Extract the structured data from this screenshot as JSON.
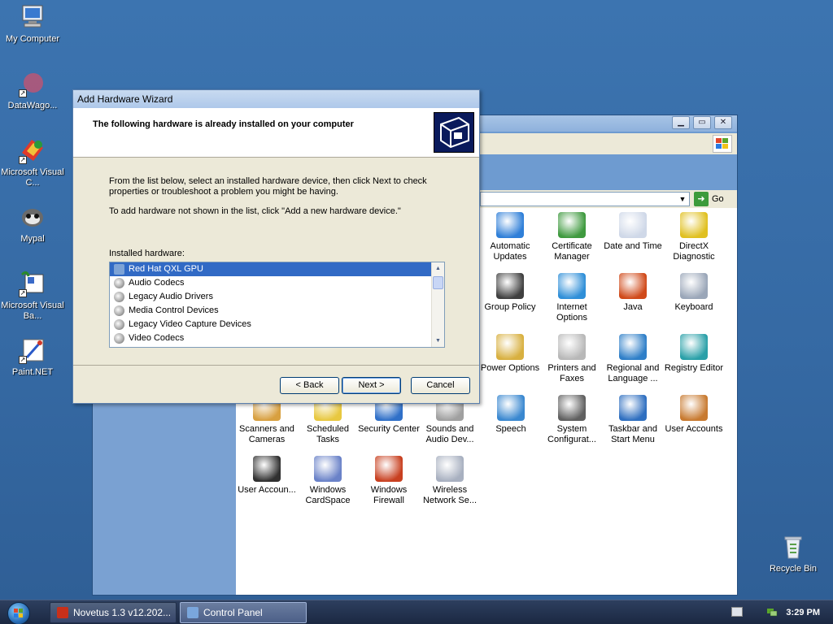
{
  "desktop": {
    "icons": [
      {
        "label": "My Computer",
        "icon": "my-computer-icon"
      },
      {
        "label": "DataWago...",
        "icon": "datawagon-icon"
      },
      {
        "label": "Microsoft Visual C...",
        "icon": "visual-c-icon"
      },
      {
        "label": "Mypal",
        "icon": "mypal-icon"
      },
      {
        "label": "Microsoft Visual Ba...",
        "icon": "visual-basic-icon"
      },
      {
        "label": "Paint.NET",
        "icon": "paint-net-icon"
      },
      {
        "label": "Recycle Bin",
        "icon": "recycle-bin-icon"
      }
    ]
  },
  "control_panel": {
    "go_label": "Go",
    "items": [
      {
        "label": "Automatic Updates",
        "icon": "automatic-updates-icon",
        "color": "#2f7fd8"
      },
      {
        "label": "Certificate Manager",
        "icon": "certificate-icon",
        "color": "#3f9a3f"
      },
      {
        "label": "Date and Time",
        "icon": "clock-icon",
        "color": "#cfd8e8"
      },
      {
        "label": "DirectX Diagnostic",
        "icon": "directx-icon",
        "color": "#e0c020"
      },
      {
        "label": "Group Policy",
        "icon": "group-policy-icon",
        "color": "#404040"
      },
      {
        "label": "Internet Options",
        "icon": "internet-options-icon",
        "color": "#2f8fd8"
      },
      {
        "label": "Java",
        "icon": "java-icon",
        "color": "#d04a1a"
      },
      {
        "label": "Keyboard",
        "icon": "keyboard-icon",
        "color": "#9aa6b8"
      },
      {
        "label": "Power Options",
        "icon": "power-options-icon",
        "color": "#d8b040"
      },
      {
        "label": "Printers and Faxes",
        "icon": "printer-icon",
        "color": "#b8b8b8"
      },
      {
        "label": "Regional and Language ...",
        "icon": "globe-icon",
        "color": "#2f7fc8"
      },
      {
        "label": "Registry Editor",
        "icon": "registry-icon",
        "color": "#2aa0a8"
      },
      {
        "label": "Scanners and Cameras",
        "icon": "scanner-icon",
        "color": "#d8a040"
      },
      {
        "label": "Scheduled Tasks",
        "icon": "scheduled-tasks-icon",
        "color": "#e8c840"
      },
      {
        "label": "Security Center",
        "icon": "security-shield-icon",
        "color": "#3070c8"
      },
      {
        "label": "Sounds and Audio Dev...",
        "icon": "speaker-icon",
        "color": "#a0a0a0"
      },
      {
        "label": "Speech",
        "icon": "speech-icon",
        "color": "#3a88d0"
      },
      {
        "label": "System Configurat...",
        "icon": "system-config-icon",
        "color": "#606060"
      },
      {
        "label": "Taskbar and Start Menu",
        "icon": "taskbar-icon",
        "color": "#2f6fc0"
      },
      {
        "label": "User Accounts",
        "icon": "user-accounts-icon",
        "color": "#c87a30"
      },
      {
        "label": "User Accoun...",
        "icon": "user-account-icon",
        "color": "#303030"
      },
      {
        "label": "Windows CardSpace",
        "icon": "cardspace-icon",
        "color": "#6a82c8"
      },
      {
        "label": "Windows Firewall",
        "icon": "firewall-icon",
        "color": "#c84020"
      },
      {
        "label": "Wireless Network Se...",
        "icon": "wireless-icon",
        "color": "#a8b0c0"
      }
    ]
  },
  "wizard": {
    "title": "Add Hardware Wizard",
    "heading": "The following hardware is already installed on your computer",
    "paragraph1": "From the list below, select an installed hardware device, then click Next to check properties or troubleshoot a problem you might be having.",
    "paragraph2": "To add hardware not shown in the list, click \"Add a new hardware device.\"",
    "list_label": "Installed hardware:",
    "devices": [
      "Red Hat QXL GPU",
      "Audio Codecs",
      "Legacy Audio Drivers",
      "Media Control Devices",
      "Legacy Video Capture Devices",
      "Video Codecs"
    ],
    "selected_device": "Red Hat QXL GPU",
    "buttons": {
      "back": "< Back",
      "next": "Next >",
      "cancel": "Cancel"
    }
  },
  "taskbar": {
    "tasks": [
      {
        "label": "Novetus 1.3 v12.202...",
        "active": false
      },
      {
        "label": "Control Panel",
        "active": true
      }
    ],
    "clock": "3:29 PM"
  }
}
